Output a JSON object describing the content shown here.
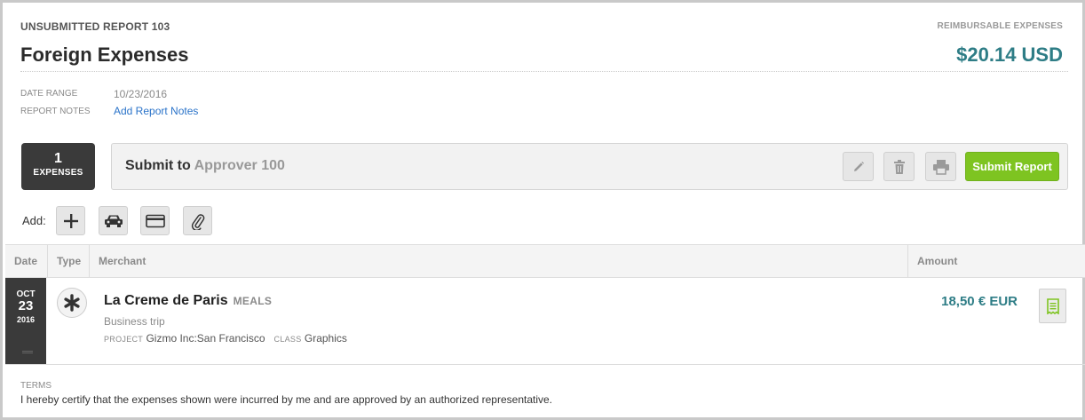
{
  "report": {
    "number_label": "UNSUBMITTED REPORT 103",
    "title": "Foreign Expenses",
    "reimbursable_label": "REIMBURSABLE EXPENSES",
    "total": "$20.14 USD",
    "accent_color": "#2e7d86"
  },
  "meta": {
    "date_range_label": "DATE RANGE",
    "date_range_value": "10/23/2016",
    "notes_label": "REPORT NOTES",
    "notes_link": "Add Report Notes"
  },
  "expense_count": {
    "number": "1",
    "label": "EXPENSES"
  },
  "submit": {
    "prefix": "Submit to",
    "approver": "Approver 100",
    "button": "Submit Report",
    "button_color": "#7ec421",
    "tools": [
      "pencil-icon",
      "trash-icon",
      "printer-icon"
    ]
  },
  "add": {
    "label": "Add:",
    "buttons": [
      "plus-icon",
      "car-icon",
      "credit-card-icon",
      "paperclip-icon"
    ]
  },
  "table": {
    "columns": {
      "date": "Date",
      "type": "Type",
      "merchant": "Merchant",
      "amount": "Amount"
    },
    "rows": [
      {
        "month": "OCT",
        "day": "23",
        "year": "2016",
        "type_icon": "asterisk-icon",
        "merchant": "La Creme de Paris",
        "category": "MEALS",
        "description": "Business trip",
        "project_label": "PROJECT",
        "project": "Gizmo Inc:San Francisco",
        "class_label": "CLASS",
        "class": "Graphics",
        "amount": "18,50 € EUR",
        "receipt_icon": "receipt-icon"
      }
    ]
  },
  "terms": {
    "label": "TERMS",
    "text": "I hereby certify that the expenses shown were incurred by me and are approved by an authorized representative."
  }
}
